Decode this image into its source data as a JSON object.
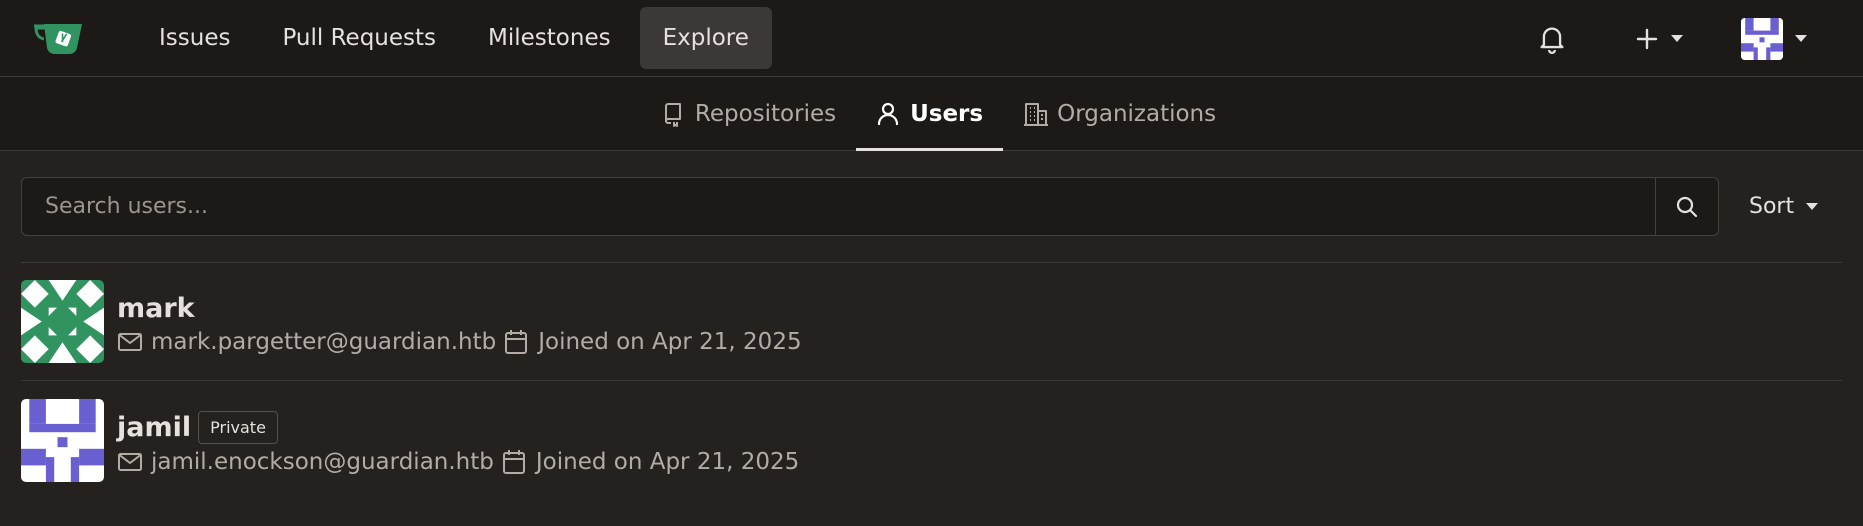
{
  "navbar": {
    "logo_icon": "gitea-teacup-logo",
    "links": [
      {
        "label": "Issues"
      },
      {
        "label": "Pull Requests"
      },
      {
        "label": "Milestones"
      },
      {
        "label": "Explore",
        "active": true
      }
    ],
    "right_icons": [
      "bell-icon",
      "plus-icon",
      "avatar"
    ]
  },
  "subnav": {
    "tabs": [
      {
        "label": "Repositories",
        "icon": "repo-icon"
      },
      {
        "label": "Users",
        "icon": "person-icon",
        "active": true
      },
      {
        "label": "Organizations",
        "icon": "organization-icon"
      }
    ]
  },
  "search": {
    "placeholder": "Search users...",
    "value": "",
    "sort_label": "Sort"
  },
  "users": [
    {
      "name": "mark",
      "email": "mark.pargetter@guardian.htb",
      "joined": "Joined on Apr 21, 2025",
      "badge": "",
      "avatar_color": "#31935f"
    },
    {
      "name": "jamil",
      "email": "jamil.enockson@guardian.htb",
      "joined": "Joined on Apr 21, 2025",
      "badge": "Private",
      "avatar_color": "#6a5fd0"
    }
  ],
  "colors": {
    "background": "#24211e",
    "navbar": "#1c1917",
    "text": "#e6e1dc",
    "muted": "#b3aca5",
    "brand_green": "#31935f"
  }
}
